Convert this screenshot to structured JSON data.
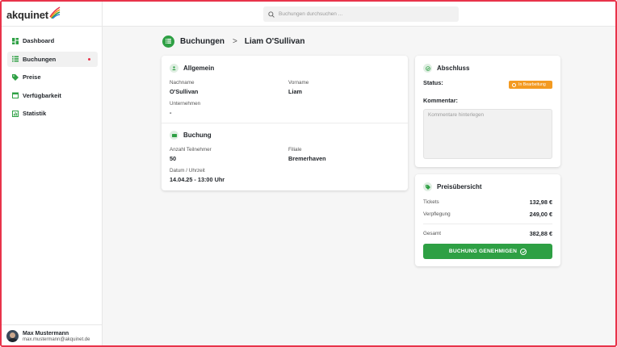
{
  "app": {
    "logo_text": "akquinet"
  },
  "search": {
    "placeholder": "Buchungen durchsuchen ..."
  },
  "sidebar": {
    "items": [
      {
        "label": "Dashboard",
        "icon": "dashboard-icon"
      },
      {
        "label": "Buchungen",
        "icon": "list-icon",
        "active": true
      },
      {
        "label": "Preise",
        "icon": "tag-icon"
      },
      {
        "label": "Verfügbarkeit",
        "icon": "calendar-icon"
      },
      {
        "label": "Statistik",
        "icon": "chart-icon"
      }
    ],
    "user": {
      "name": "Max Mustermann",
      "email": "max.mustermann@akquinet.de"
    }
  },
  "breadcrumb": {
    "section": "Buchungen",
    "separator": ">",
    "current": "Liam O'Sullivan"
  },
  "general": {
    "title": "Allgemein",
    "lastname_label": "Nachname",
    "lastname": "O'Sullivan",
    "firstname_label": "Vorname",
    "firstname": "Liam",
    "company_label": "Unternehmen",
    "company": "-"
  },
  "booking": {
    "title": "Buchung",
    "participants_label": "Anzahl Teilnehmer",
    "participants": "50",
    "branch_label": "Filiale",
    "branch": "Bremerhaven",
    "datetime_label": "Datum / Uhrzeit",
    "datetime": "14.04.25 - 13:00 Uhr"
  },
  "completion": {
    "title": "Abschluss",
    "status_label": "Status:",
    "status": "In Bearbeitung",
    "comments_label": "Kommentar:",
    "comments_placeholder": "Kommentare hinterlegen",
    "comments_value": ""
  },
  "prices": {
    "title": "Preisübersicht",
    "tickets_label": "Tickets",
    "tickets": "132,98 €",
    "catering_label": "Verpflegung",
    "catering": "249,00 €",
    "total_label": "Gesamt",
    "total": "382,88 €",
    "approve_label": "BUCHUNG GENEHMIGEN"
  },
  "colors": {
    "accent": "#2ea044",
    "status": "#f39a21",
    "frame": "#e8334a",
    "notification": "#e8334a"
  }
}
